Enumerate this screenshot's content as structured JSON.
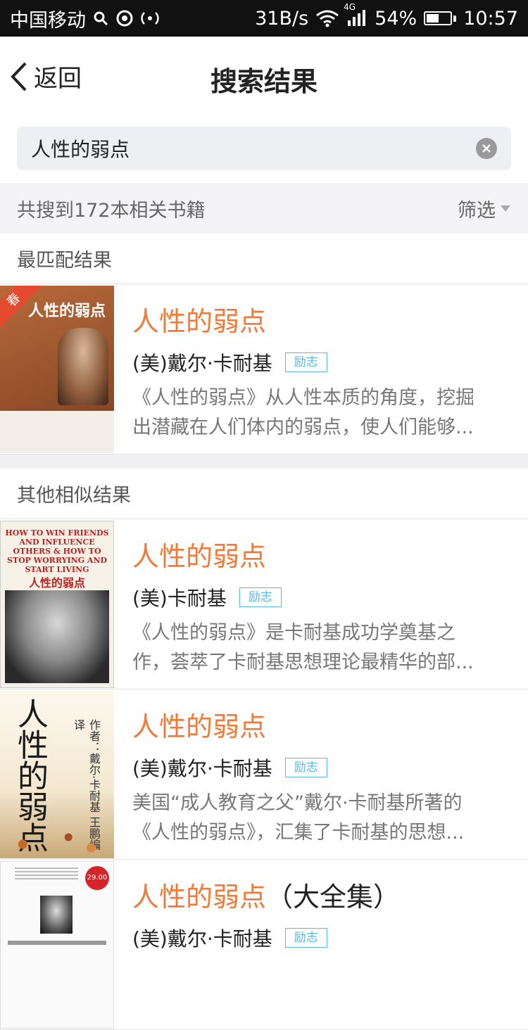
{
  "status_bar": {
    "carrier": "中国移动",
    "speed": "31B/s",
    "network": "4G",
    "battery": "54%",
    "battery_level": 0.54,
    "time": "10:57"
  },
  "nav": {
    "back_label": "返回",
    "title": "搜索结果"
  },
  "search": {
    "query": "人性的弱点"
  },
  "results_bar": {
    "count_text": "共搜到172本相关书籍",
    "filter_label": "筛选"
  },
  "sections": {
    "best": "最匹配结果",
    "others": "其他相似结果"
  },
  "covers": {
    "best_ribbon": "春",
    "best_cover_title": "人性的弱点",
    "book2_cover_english": "HOW TO WIN FRIENDS AND INFLUENCE OTHERS & HOW TO STOP WORRYING AND START LIVING",
    "book2_cover_title": "人性的弱点",
    "book3_calligraphy": "人性的弱点",
    "book3_byline": "作者：戴尔·卡耐基 王鹏编译",
    "book4_badge": "29.00"
  },
  "best_match": {
    "title": "人性的弱点",
    "author": "(美)戴尔·卡耐基",
    "tag": "励志",
    "desc_line1": "《人性的弱点》从人性本质的角度，挖掘",
    "desc_line2": "出潜藏在人们体内的弱点，使人们能够..."
  },
  "others": [
    {
      "title": "人性的弱点",
      "title_suffix": "",
      "author": "(美)卡耐基",
      "tag": "励志",
      "desc_line1": "《人性的弱点》是卡耐基成功学奠基之",
      "desc_line2": "作，荟萃了卡耐基思想理论最精华的部..."
    },
    {
      "title": "人性的弱点",
      "title_suffix": "",
      "author": "(美)戴尔·卡耐基",
      "tag": "励志",
      "desc_line1": "美国“成人教育之父”戴尔·卡耐基所著的",
      "desc_line2": "《人性的弱点》，汇集了卡耐基的思想..."
    },
    {
      "title": "人性的弱点",
      "title_suffix": "（大全集）",
      "author": "(美)戴尔·卡耐基",
      "tag": "励志",
      "desc_line1": "",
      "desc_line2": ""
    }
  ]
}
